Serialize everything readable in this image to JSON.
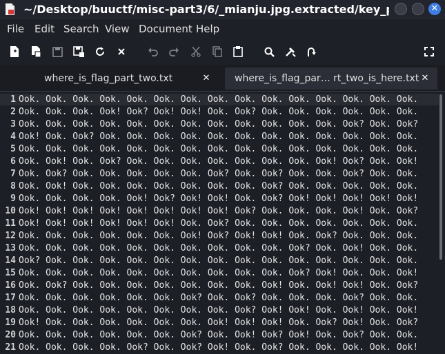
{
  "window": {
    "title": "~/Desktop/buuctf/misc-part3/6/_mianju.jpg.extracted/key_part_two/whe",
    "close_glyph": "✕"
  },
  "menu": [
    "File",
    "Edit",
    "Search",
    "View",
    "Document",
    "Help"
  ],
  "toolbar_icons": [
    "new-file-icon",
    "new-from-template-icon",
    "save-icon",
    "save-as-icon",
    "reload-icon",
    "close-icon",
    "undo-icon",
    "redo-icon",
    "cut-icon",
    "copy-icon",
    "paste-icon",
    "search-icon",
    "replace-icon",
    "goto-icon",
    "fullscreen-icon"
  ],
  "tabs": [
    {
      "label": "where_is_flag_part_two.txt",
      "close": "✕"
    },
    {
      "label": "where_is_flag_par… rt_two_is_here.txt",
      "close": "✕"
    }
  ],
  "editor": {
    "line_numbers": [
      "1",
      "2",
      "3",
      "4",
      "5",
      "6",
      "7",
      "8",
      "9",
      "10",
      "11",
      "12",
      "13",
      "14",
      "15",
      "16",
      "17",
      "18",
      "19",
      "20",
      "21"
    ],
    "lines": [
      "Ook. Ook. Ook. Ook. Ook. Ook. Ook. Ook. Ook. Ook. Ook. Ook. Ook. Ook. Ook.",
      "Ook. Ook. Ook. Ook! Ook? Ook! Ook! Ook. Ook? Ook. Ook. Ook. Ook. Ook. Ook.",
      "Ook. Ook. Ook. Ook. Ook. Ook. Ook. Ook. Ook. Ook. Ook. Ook. Ook? Ook. Ook?",
      "Ook! Ook. Ook? Ook. Ook. Ook. Ook. Ook. Ook. Ook. Ook. Ook. Ook. Ook. Ook.",
      "Ook. Ook. Ook. Ook. Ook. Ook. Ook. Ook. Ook. Ook. Ook. Ook. Ook. Ook. Ook.",
      "Ook. Ook! Ook. Ook? Ook. Ook. Ook. Ook. Ook. Ook. Ook. Ook! Ook? Ook. Ook!",
      "Ook. Ook? Ook. Ook. Ook. Ook. Ook. Ook? Ook. Ook? Ook. Ook. Ook? Ook. Ook.",
      "Ook. Ook! Ook. Ook. Ook. Ook. Ook. Ook. Ook. Ook? Ook. Ook. Ook. Ook. Ook.",
      "Ook. Ook. Ook. Ook. Ook! Ook? Ook! Ook! Ook. Ook? Ook! Ook! Ook! Ook! Ook!",
      "Ook! Ook! Ook! Ook! Ook! Ook! Ook! Ook! Ook? Ook. Ook. Ook. Ook! Ook. Ook?",
      "Ook! Ook! Ook! Ook! Ook! Ook! Ook. Ook? Ook. Ook. Ook. Ook. Ook. Ook. Ook.",
      "Ook. Ook. Ook. Ook. Ook. Ook. Ook! Ook? Ook! Ook! Ook. Ook? Ook. Ook. Ook.",
      "Ook. Ook. Ook. Ook. Ook. Ook. Ook. Ook. Ook. Ook. Ook? Ook. Ook! Ook. Ook.",
      "Ook? Ook. Ook. Ook. Ook. Ook. Ook. Ook. Ook. Ook. Ook. Ook. Ook. Ook. Ook.",
      "Ook. Ook. Ook. Ook. Ook. Ook. Ook. Ook. Ook. Ook. Ook? Ook! Ook. Ook. Ook!",
      "Ook. Ook? Ook. Ook. Ook. Ook. Ook. Ook. Ook. Ook! Ook. Ook! Ook! Ook. Ook?",
      "Ook. Ook. Ook. Ook. Ook. Ook. Ook? Ook. Ook? Ook. Ook. Ook. Ook? Ook. Ook.",
      "Ook. Ook. Ook. Ook. Ook. Ook. Ook. Ook. Ook? Ook! Ook! Ook. Ook! Ook. Ook!",
      "Ook! Ook. Ook. Ook. Ook. Ook. Ook. Ook! Ook! Ook! Ook. Ook? Ook! Ook. Ook?",
      "Ook. Ook. Ook. Ook. Ook. Ook. Ook? Ook. Ook! Ook? Ook! Ook. Ook? Ook. Ook.",
      "Ook. Ook. Ook. Ook. Ook? Ook. Ook? Ook! Ook. Ook? Ook. Ook. Ook. Ook. Ook!"
    ]
  }
}
